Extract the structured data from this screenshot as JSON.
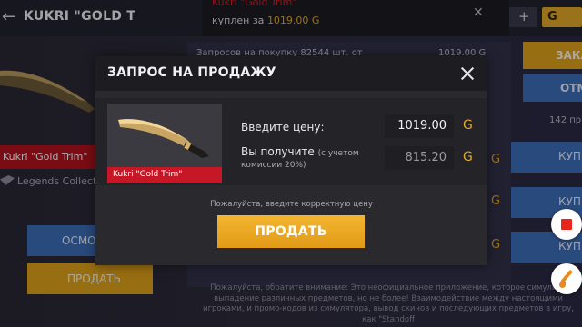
{
  "background": {
    "title": "KUKRI \"GOLD T",
    "skin_name": "Kukri \"Gold Trim\"",
    "collection": "Legends Collect",
    "inspect_button": "ОСМОТ",
    "sell_button": "ПРОДАТЬ",
    "requests_text": "Запросов на покупку 82544 шт. от",
    "requests_price": "1019.00 G",
    "gold_symbol": "G",
    "plus": "+",
    "order_button": "ЗАКА",
    "cancel_button": "ОТМ",
    "count_text": "142 пр",
    "buy_buttons": [
      "КУПИ",
      "КУПИ",
      "КУПИ",
      "КУПИ"
    ],
    "footer": "Пожалуйста, обратите внимание: Это неофициальное приложение, которое симулиру выпадение различных предметов, но не более! Взаимодействие между настоящими игроками, и промо-кодов из симулятора, вывод скинов и последующих предметов в игру, как \"Standoff"
  },
  "toast": {
    "title": "Kukri \"Gold Trim\"",
    "line_prefix": "куплен за",
    "line_amount": "1019.00 G",
    "close": "✕"
  },
  "modal": {
    "title": "ЗАПРОС НА ПРОДАЖУ",
    "item_label": "Kukri \"Gold Trim\"",
    "price_label": "Введите цену:",
    "price_value": "1019.00",
    "receive_label": "Вы получите",
    "receive_note_a": "(с учетом",
    "receive_note_b": "комиссии 20%)",
    "receive_value": "815.20",
    "currency": "G",
    "hint": "Пожалуйста, введите корректную цену",
    "sell_button": "ПРОДАТЬ"
  },
  "colors": {
    "accent_gold": "#e3a928",
    "accent_red": "#c51726",
    "accent_blue": "#3d6db8"
  }
}
